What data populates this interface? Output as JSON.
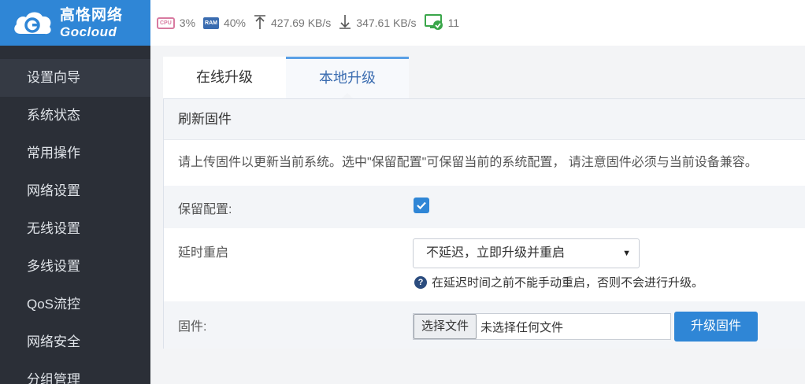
{
  "brand": {
    "name_cn": "高恪网络",
    "name_en": "Gocloud"
  },
  "topbar": {
    "cpu": {
      "icon": "cpu-chip-icon",
      "badge": "CPU",
      "value": "3%"
    },
    "ram": {
      "icon": "ram-chip-icon",
      "badge": "RAM",
      "value": "40%"
    },
    "upload": {
      "icon": "upload-arrow-icon",
      "value": "427.69 KB/s"
    },
    "download": {
      "icon": "download-arrow-icon",
      "value": "347.61 KB/s"
    },
    "online": {
      "icon": "online-devices-icon",
      "value": "11"
    }
  },
  "sidebar": {
    "items": [
      {
        "label": "设置向导",
        "active": true
      },
      {
        "label": "系统状态"
      },
      {
        "label": "常用操作"
      },
      {
        "label": "网络设置"
      },
      {
        "label": "无线设置"
      },
      {
        "label": "多线设置"
      },
      {
        "label": "QoS流控"
      },
      {
        "label": "网络安全"
      },
      {
        "label": "分组管理"
      }
    ]
  },
  "tabs": [
    {
      "label": "在线升级"
    },
    {
      "label": "本地升级",
      "active": true
    }
  ],
  "panel": {
    "title": "刷新固件",
    "description": "请上传固件以更新当前系统。选中\"保留配置\"可保留当前的系统配置， 请注意固件必须与当前设备兼容。",
    "keep_config": {
      "label": "保留配置:",
      "checked": true
    },
    "delay_reboot": {
      "label": "延时重启",
      "selected": "不延迟，立即升级并重启",
      "hint": "在延迟时间之前不能手动重启，否则不会进行升级。"
    },
    "firmware": {
      "label": "固件:",
      "choose_button": "选择文件",
      "no_file": "未选择任何文件",
      "upgrade_button": "升级固件"
    }
  },
  "colors": {
    "accent": "#2f86d6",
    "sidebar_bg": "#2b2f37",
    "sidebar_active": "#353a44"
  }
}
